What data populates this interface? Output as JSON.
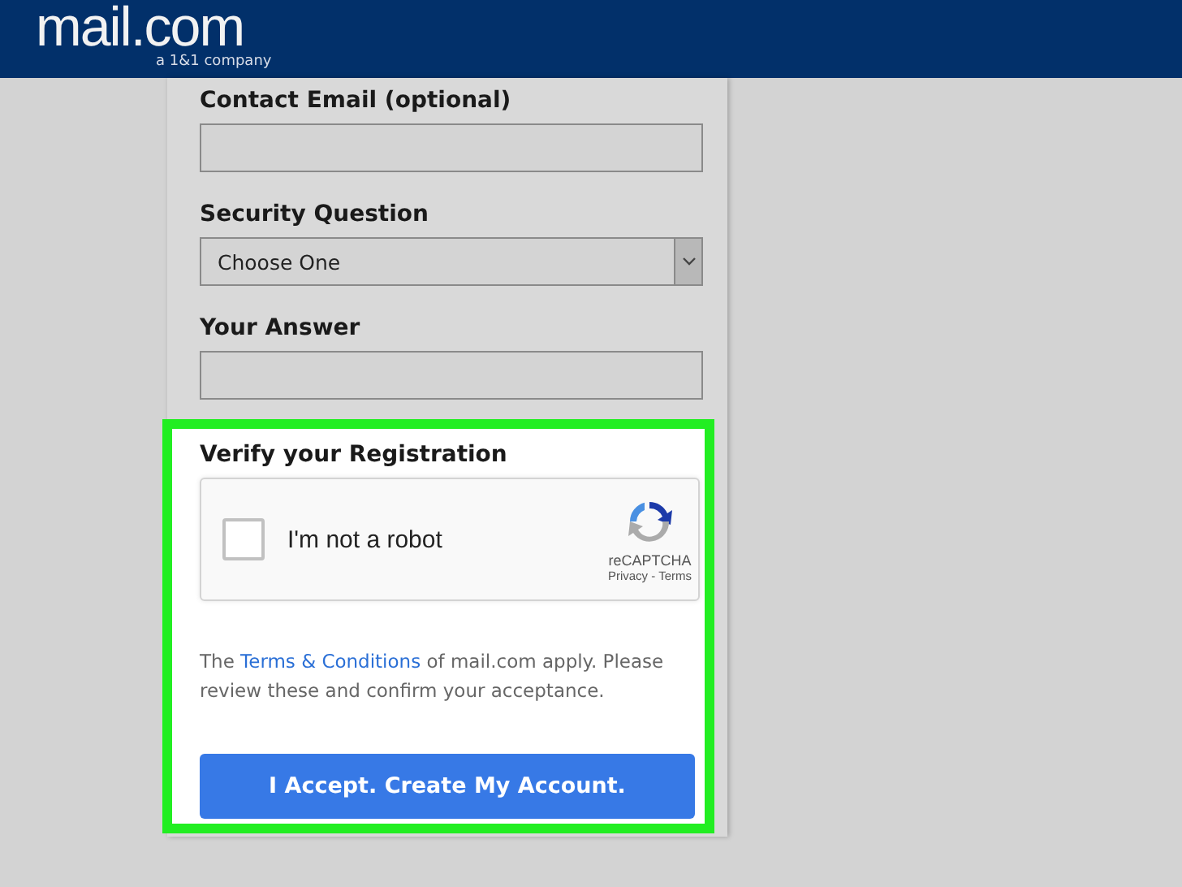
{
  "header": {
    "logo": "mail.com",
    "tagline": "a 1&1 company"
  },
  "form": {
    "fields": [
      {
        "kind": "input",
        "label": "Contact Email (optional)"
      },
      {
        "kind": "select",
        "label": "Security Question",
        "value": "Choose One"
      },
      {
        "kind": "input",
        "label": "Your Answer"
      }
    ],
    "verify": {
      "title": "Verify your Registration",
      "captcha": {
        "label": "I'm not a robot",
        "checked": false,
        "brand": "reCAPTCHA",
        "links": "Privacy - Terms"
      },
      "terms": {
        "before": "The ",
        "link": "Terms & Conditions",
        "after": " of mail.com apply. Please review these and confirm your acceptance."
      },
      "button": "I Accept. Create My Account."
    }
  }
}
